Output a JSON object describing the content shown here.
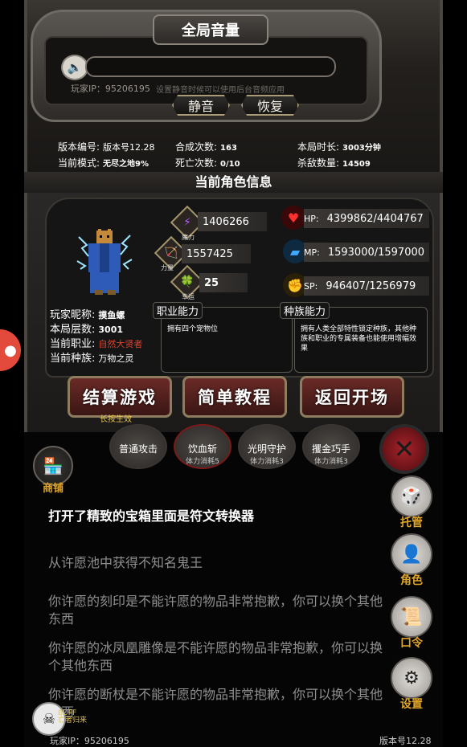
{
  "volume": {
    "title": "全局音量",
    "player_ip": "玩家IP：95206195",
    "mute_note": "设置静音时候可以使用后台音频应用",
    "mute_button": "静音",
    "restore_button": "恢复"
  },
  "stats": {
    "version_label": "版本编号:",
    "version_value": "版本号12.28",
    "mode_label": "当前模式:",
    "mode_value": "无尽之地9%",
    "merge_label": "合成次数:",
    "merge_value": "163",
    "death_label": "死亡次数:",
    "death_value": "0/10",
    "duration_label": "本局时长:",
    "duration_value": "3003分钟",
    "kills_label": "杀敌数量:",
    "kills_value": "14509"
  },
  "character": {
    "section_title": "当前角色信息",
    "magic_value": "1406266",
    "magic_label": "魔力",
    "power_value": "1557425",
    "power_label": "力量",
    "luck_value": "25",
    "luck_label": "幸运",
    "hp_label": "HP:",
    "hp_value": "4399862/4404767",
    "mp_label": "MP:",
    "mp_value": "1593000/1597000",
    "sp_label": "SP:",
    "sp_value": "946407/1256979",
    "nickname_label": "玩家昵称:",
    "nickname_value": "摸鱼螺",
    "floor_label": "本局层数:",
    "floor_value": "3001",
    "job_label": "当前职业:",
    "job_value": "自然大贤者",
    "race_label": "当前种族:",
    "race_value": "万物之灵",
    "job_ability_label": "职业能力",
    "job_ability_text": "拥有四个宠物位",
    "race_ability_label": "种族能力",
    "race_ability_text": "拥有人类全部特性锁定种族，其他种族和职业的专属装备也能使用增幅效果"
  },
  "actions": {
    "settle_game": "结算游戏",
    "settle_note": "长按生效",
    "tutorial": "简单教程",
    "return_start": "返回开场"
  },
  "skills": [
    {
      "name": "普通攻击",
      "cost": ""
    },
    {
      "name": "饮血斩",
      "cost": "体力消耗5"
    },
    {
      "name": "光明守护",
      "cost": "体力消耗3"
    },
    {
      "name": "攫金巧手",
      "cost": "体力消耗3"
    }
  ],
  "shop_label": "商铺",
  "log": [
    "打开了精致的宝箱里面是符文转换器",
    "从许愿池中获得不知名鬼王",
    "你许愿的刻印是不能许愿的物品非常抱歉，你可以换个其他东西",
    "你许愿的冰凤凰雕像是不能许愿的物品非常抱歉，你可以换个其他东西",
    "你许愿的断杖是不能许愿的物品非常抱歉，你可以换个其他东西"
  ],
  "right_menu": {
    "auto": "托管",
    "role": "角色",
    "code": "口令",
    "settings": "设置"
  },
  "buff": {
    "label_top": "BUFF",
    "label_bottom": "亡者归来"
  },
  "footer": {
    "player_ip": "玩家IP：95206195",
    "version": "版本号12.28"
  },
  "colors": {
    "gold": "#e0a528",
    "job_highlight": "#e0412c",
    "button_red": "#6a2a26"
  }
}
